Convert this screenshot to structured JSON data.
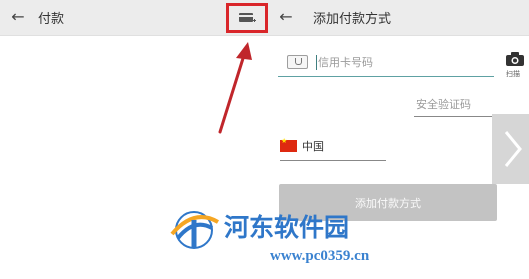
{
  "left_screen": {
    "back_icon": "arrow-left-icon",
    "title": "付款",
    "add_card_icon": "add-card-icon"
  },
  "right_screen": {
    "back_icon": "arrow-left-icon",
    "title": "添加付款方式",
    "card_number_placeholder": "信用卡号码",
    "scan_icon": "camera-icon",
    "scan_label": "扫描",
    "security_code_placeholder": "安全验证码",
    "country": "中国",
    "submit_label": "添加付款方式",
    "next_icon": "chevron-right-icon"
  },
  "watermark": {
    "name": "河东软件园",
    "url": "www.pc0359.cn"
  },
  "colors": {
    "highlight": "#d9262a",
    "appbar": "#ececec",
    "button": "#c3c3c3",
    "watermark": "#2f77c9"
  }
}
